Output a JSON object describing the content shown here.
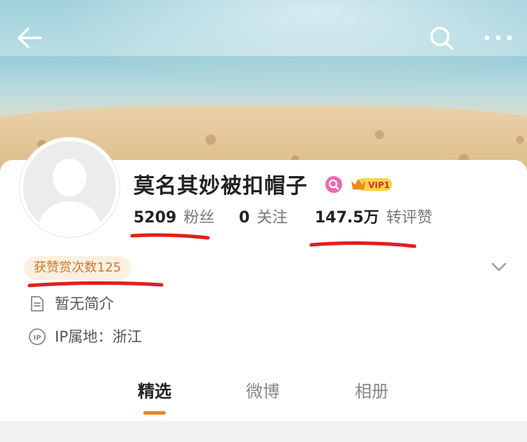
{
  "header": {
    "back_icon": "back-arrow-icon",
    "search_icon": "search-icon",
    "more_icon": "more-dots-icon"
  },
  "profile": {
    "username": "莫名其妙被扣帽子",
    "verified_icon": "verified-badge-icon",
    "vip_label": "VIP1",
    "stats": {
      "followers_count": "5209",
      "followers_label": "粉丝",
      "following_count": "0",
      "following_label": "关注",
      "interactions_count": "147.5万",
      "interactions_label": "转评赞"
    },
    "reward_badge": "获赞赏次数125",
    "bio": "暂无简介",
    "ip_location": "IP属地：浙江"
  },
  "tabs": [
    {
      "label": "精选",
      "active": true
    },
    {
      "label": "微博",
      "active": false
    },
    {
      "label": "相册",
      "active": false
    }
  ],
  "colors": {
    "accent": "#f58220",
    "annotation_red": "#e0201a",
    "reward_text": "#c97a2c",
    "reward_bg": "#fdf0e1"
  }
}
